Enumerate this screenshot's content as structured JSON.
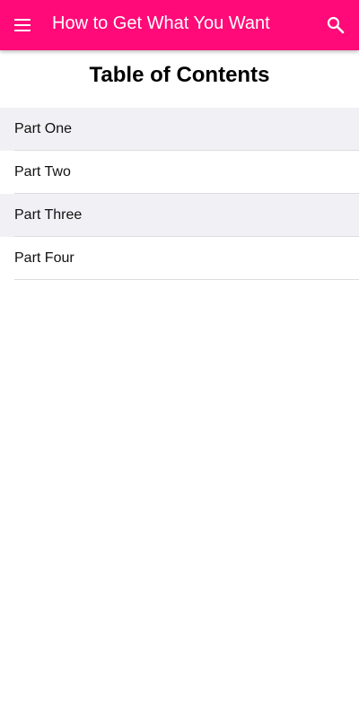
{
  "app_bar": {
    "title": "How to Get What You Want",
    "color": "#ff0a78",
    "left_icon": "menu-icon",
    "right_icon": "search-icon"
  },
  "toc": {
    "heading": "Table of Contents",
    "items": [
      {
        "label": "Part One"
      },
      {
        "label": "Part Two"
      },
      {
        "label": "Part Three"
      },
      {
        "label": "Part Four"
      }
    ]
  }
}
